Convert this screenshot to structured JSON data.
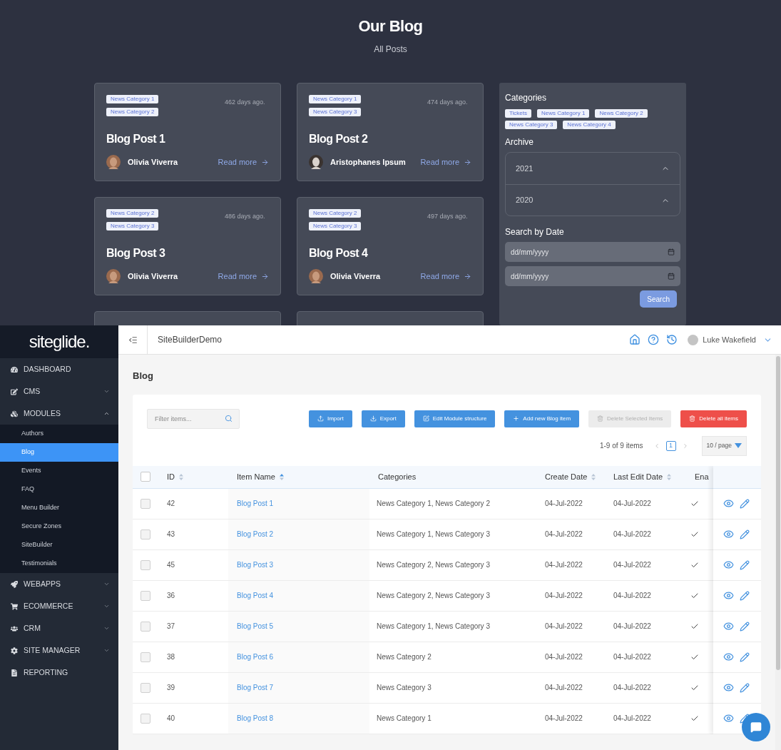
{
  "blog_page": {
    "title": "Our Blog",
    "subtitle": "All Posts",
    "posts": [
      {
        "tags": [
          "News Category 1",
          "News Category 2"
        ],
        "age": "462 days ago.",
        "title": "Blog Post 1",
        "author": "Olivia Viverra",
        "link": "Read more"
      },
      {
        "tags": [
          "News Category 1",
          "News Category 3"
        ],
        "age": "474 days ago.",
        "title": "Blog Post 2",
        "author": "Aristophanes Ipsum",
        "link": "Read more"
      },
      {
        "tags": [
          "News Category 2",
          "News Category 3"
        ],
        "age": "486 days ago.",
        "title": "Blog Post 3",
        "author": "Olivia Viverra",
        "link": "Read more"
      },
      {
        "tags": [
          "News Category 2",
          "News Category 3"
        ],
        "age": "497 days ago.",
        "title": "Blog Post 4",
        "author": "Olivia Viverra",
        "link": "Read more"
      }
    ],
    "sidebar": {
      "categories_heading": "Categories",
      "categories": [
        "Tickets",
        "News Category 1",
        "News Category 2",
        "News Category 3",
        "News Category 4"
      ],
      "archive_heading": "Archive",
      "archive": [
        "2021",
        "2020"
      ],
      "date_heading": "Search by Date",
      "date_fields": [
        {
          "placeholder": "dd/mm/yyyy"
        },
        {
          "placeholder": "dd/mm/yyyy"
        }
      ],
      "search_button": "Search"
    }
  },
  "admin": {
    "logo": "siteglide.",
    "nav": [
      {
        "label": "DASHBOARD"
      },
      {
        "label": "CMS",
        "expanded": false
      },
      {
        "label": "MODULES",
        "expanded": true,
        "children": [
          {
            "label": "Authors",
            "selected": false
          },
          {
            "label": "Blog",
            "selected": true
          },
          {
            "label": "Events",
            "selected": false
          },
          {
            "label": "FAQ",
            "selected": false
          },
          {
            "label": "Menu Builder",
            "selected": false
          },
          {
            "label": "Secure Zones",
            "selected": false
          },
          {
            "label": "SiteBuilder",
            "selected": false
          },
          {
            "label": "Testimonials",
            "selected": false
          }
        ]
      },
      {
        "label": "WEBAPPS",
        "expanded": false
      },
      {
        "label": "ECOMMERCE",
        "expanded": false
      },
      {
        "label": "CRM",
        "expanded": false
      },
      {
        "label": "SITE MANAGER",
        "expanded": false
      },
      {
        "label": "REPORTING"
      }
    ],
    "header": {
      "site": "SiteBuilderDemo",
      "user": "Luke Wakefield"
    },
    "page_title": "Blog",
    "filter": {
      "placeholder": "Filter items..."
    },
    "buttons": [
      {
        "label": "Import",
        "kind": "primary"
      },
      {
        "label": "Export",
        "kind": "primary"
      },
      {
        "label": "Edit Module structure",
        "kind": "primary"
      },
      {
        "label": "Add new Blog item",
        "kind": "primary"
      },
      {
        "label": "Delete Selected Items",
        "kind": "disabled"
      },
      {
        "label": "Delete all items",
        "kind": "danger"
      }
    ],
    "pagination": {
      "summary": "1-9 of 9 items",
      "pages": [
        {
          "label": "1",
          "selected": true
        }
      ],
      "page_size": "10 / page"
    },
    "table": {
      "all_checked": false,
      "columns": [
        {
          "label": "ID",
          "sorted": false
        },
        {
          "label": "Item Name",
          "sorted": true
        },
        {
          "label": "Categories"
        },
        {
          "label": "Create Date",
          "sorted": false
        },
        {
          "label": "Last Edit Date",
          "sorted": false
        },
        {
          "label": "Ena"
        }
      ],
      "rows": [
        {
          "checked": false,
          "id": "42",
          "name": "Blog Post 1",
          "categories": "News Category 1, News Category 2",
          "created": "04-Jul-2022",
          "edited": "04-Jul-2022",
          "enabled": true
        },
        {
          "checked": false,
          "id": "43",
          "name": "Blog Post 2",
          "categories": "News Category 1, News Category 3",
          "created": "04-Jul-2022",
          "edited": "04-Jul-2022",
          "enabled": true
        },
        {
          "checked": false,
          "id": "45",
          "name": "Blog Post 3",
          "categories": "News Category 2, News Category 3",
          "created": "04-Jul-2022",
          "edited": "04-Jul-2022",
          "enabled": true
        },
        {
          "checked": false,
          "id": "36",
          "name": "Blog Post 4",
          "categories": "News Category 2, News Category 3",
          "created": "04-Jul-2022",
          "edited": "04-Jul-2022",
          "enabled": true
        },
        {
          "checked": false,
          "id": "37",
          "name": "Blog Post 5",
          "categories": "News Category 1, News Category 3",
          "created": "04-Jul-2022",
          "edited": "04-Jul-2022",
          "enabled": true
        },
        {
          "checked": false,
          "id": "38",
          "name": "Blog Post 6",
          "categories": "News Category 2",
          "created": "04-Jul-2022",
          "edited": "04-Jul-2022",
          "enabled": true
        },
        {
          "checked": false,
          "id": "39",
          "name": "Blog Post 7",
          "categories": "News Category 3",
          "created": "04-Jul-2022",
          "edited": "04-Jul-2022",
          "enabled": true
        },
        {
          "checked": false,
          "id": "40",
          "name": "Blog Post 8",
          "categories": "News Category 1",
          "created": "04-Jul-2022",
          "edited": "04-Jul-2022",
          "enabled": true
        }
      ]
    }
  }
}
